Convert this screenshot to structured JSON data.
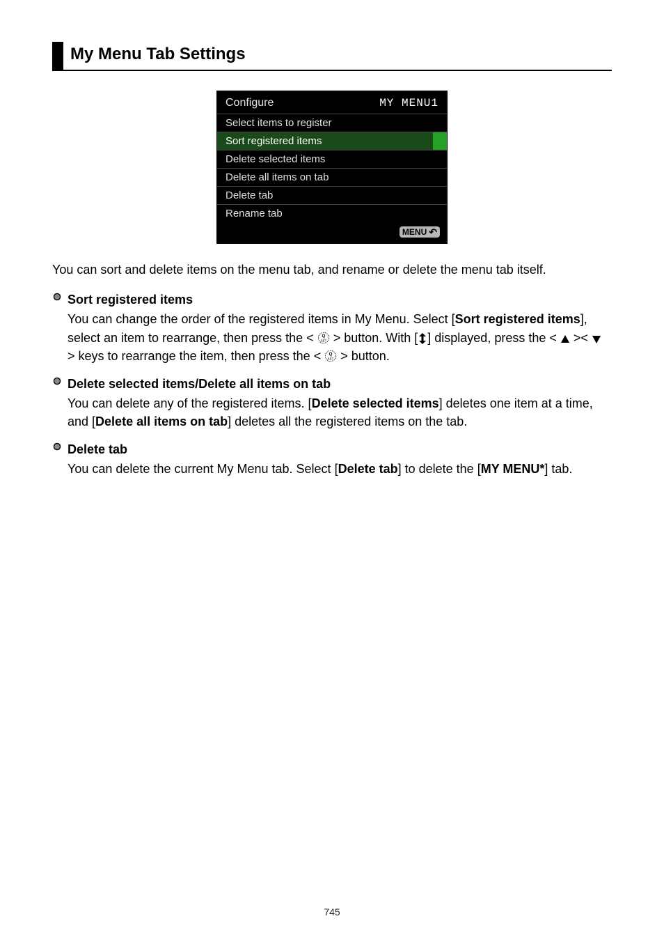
{
  "title": "My Menu Tab Settings",
  "camera_screen": {
    "header_left": "Configure",
    "header_right": "MY MENU1",
    "items": [
      "Select items to register",
      "Sort registered items",
      "Delete selected items",
      "Delete all items on tab",
      "Delete tab",
      "Rename tab"
    ],
    "highlight_index": 1,
    "footer_badge": "MENU"
  },
  "intro": "You can sort and delete items on the menu tab, and rename or delete the menu tab itself.",
  "sections": {
    "sort": {
      "heading": "Sort registered items",
      "p1a": "You can change the order of the registered items in My Menu. Select [",
      "p1b": "Sort registered items",
      "p1c": "], select an item to rearrange, then press the < ",
      "p1d": " > button. With [",
      "p1e": "] displayed, press the < ",
      "p1f": " >< ",
      "p1g": " > keys to rearrange the item, then press the < ",
      "p1h": " > button."
    },
    "delete_items": {
      "heading": "Delete selected items/Delete all items on tab",
      "p1a": "You can delete any of the registered items. [",
      "p1b": "Delete selected items",
      "p1c": "] deletes one item at a time, and [",
      "p1d": "Delete all items on tab",
      "p1e": "] deletes all the registered items on the tab."
    },
    "delete_tab": {
      "heading": "Delete tab",
      "p1a": "You can delete the current My Menu tab. Select [",
      "p1b": "Delete tab",
      "p1c": "] to delete the [",
      "p1d": "MY MENU*",
      "p1e": "] tab."
    }
  },
  "page_number": "745"
}
